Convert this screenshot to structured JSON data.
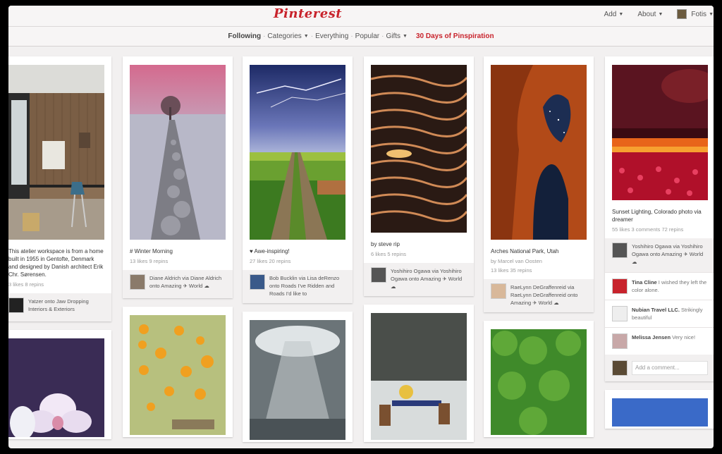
{
  "header": {
    "logo": "Pinterest",
    "add_label": "Add",
    "about_label": "About",
    "user_label": "Fotis"
  },
  "subnav": {
    "following": "Following",
    "categories": "Categories",
    "everything": "Everything",
    "popular": "Popular",
    "gifts": "Gifts",
    "promo": "30 Days of Pinspiration",
    "sep": "·"
  },
  "pins": {
    "p1": {
      "desc": "This atelier workspace is from a home built in 1955 in Gentofte, Denmark and designed by Danish architect Erik Chr. Sørensen.",
      "stats": "3 likes    8 repins",
      "attr": "Yatzer onto Jaw Dropping Interiors & Exteriors"
    },
    "p2": {
      "desc": "# Winter Morning",
      "stats": "13 likes    9 repins",
      "attr": "Diane Aldrich via Diane Aldrich onto Amazing ✈ World ☁"
    },
    "p3": {
      "desc": "♥ Awe-inspiring!",
      "stats": "27 likes    20 repins",
      "attr": "Bob Bucklin via Lisa deRenzo onto Roads I've Ridden and Roads I'd like to"
    },
    "p4": {
      "desc": "by steve rip",
      "stats": "6 likes    5 repins",
      "attr": "Yoshihiro Ogawa via Yoshihiro Ogawa onto Amazing ✈ World ☁"
    },
    "p5": {
      "desc": "Arches National Park, Utah",
      "via": "by Marcel van Oosten",
      "stats": "13 likes    35 repins",
      "attr": "RaeLynn DeGraffenreid via RaeLynn DeGraffenreid onto Amazing ✈ World ☁"
    },
    "p6": {
      "desc": "Sunset Lighting, Colorado photo via dreamer",
      "stats": "55 likes    3 comments    72 repins",
      "attr": "Yoshihiro Ogawa via Yoshihiro Ogawa onto Amazing ✈ World ☁",
      "comments": [
        {
          "name": "Tina Cline",
          "text": "I wished they left the color alone."
        },
        {
          "name": "Nubian Travel LLC.",
          "text": "Strikingly beautiful"
        },
        {
          "name": "Melissa Jensen",
          "text": "Very nice!"
        }
      ],
      "add_comment_placeholder": "Add a comment..."
    }
  }
}
